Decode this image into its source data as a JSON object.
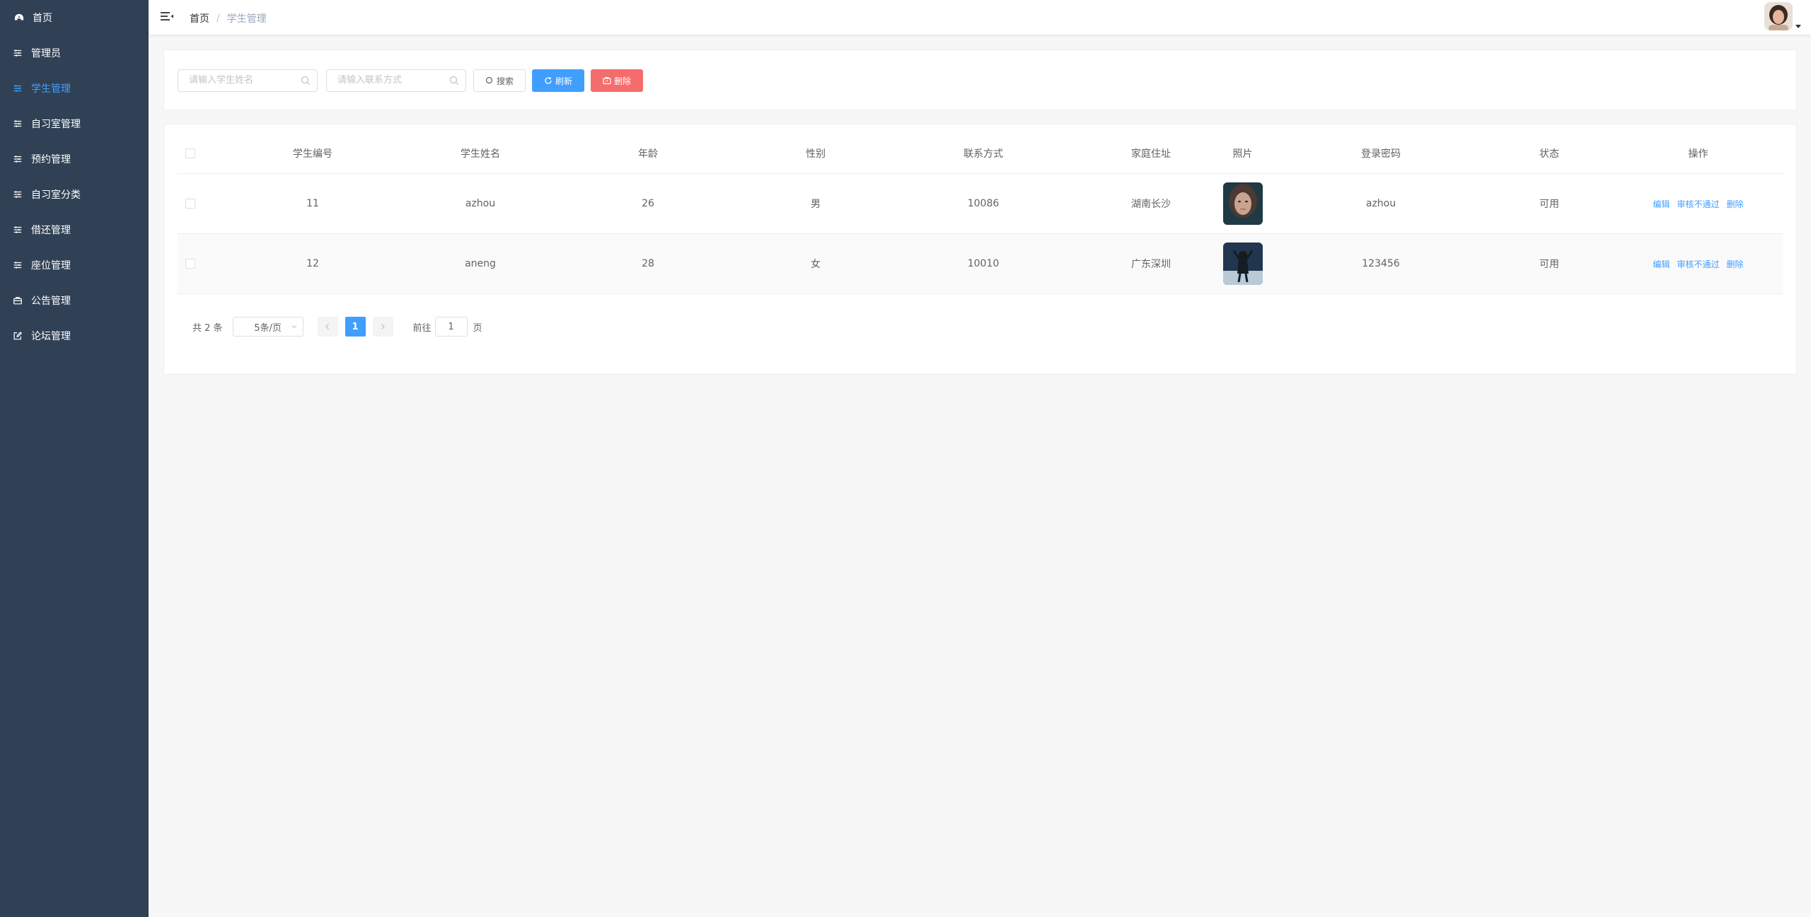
{
  "sidebar": {
    "items": [
      {
        "label": "首页",
        "icon": "dashboard-icon"
      },
      {
        "label": "管理员",
        "icon": "sliders-icon"
      },
      {
        "label": "学生管理",
        "icon": "sliders-icon",
        "active": true
      },
      {
        "label": "自习室管理",
        "icon": "sliders-icon"
      },
      {
        "label": "预约管理",
        "icon": "sliders-icon"
      },
      {
        "label": "自习室分类",
        "icon": "sliders-icon"
      },
      {
        "label": "借还管理",
        "icon": "sliders-icon"
      },
      {
        "label": "座位管理",
        "icon": "sliders-icon"
      },
      {
        "label": "公告管理",
        "icon": "briefcase-icon"
      },
      {
        "label": "论坛管理",
        "icon": "edit-icon"
      }
    ]
  },
  "header": {
    "breadcrumb_home": "首页",
    "breadcrumb_separator": "/",
    "breadcrumb_current": "学生管理"
  },
  "search": {
    "name_placeholder": "请输入学生姓名",
    "phone_placeholder": "请输入联系方式",
    "search_label": "搜索",
    "refresh_label": "刷新",
    "delete_label": "删除"
  },
  "table": {
    "headers": {
      "id": "学生编号",
      "name": "学生姓名",
      "age": "年龄",
      "sex": "性别",
      "phone": "联系方式",
      "address": "家庭住址",
      "photo": "照片",
      "password": "登录密码",
      "status": "状态",
      "ops": "操作"
    },
    "rows": [
      {
        "id": "11",
        "name": "azhou",
        "age": "26",
        "sex": "男",
        "phone": "10086",
        "address": "湖南长沙",
        "password": "azhou",
        "status": "可用"
      },
      {
        "id": "12",
        "name": "aneng",
        "age": "28",
        "sex": "女",
        "phone": "10010",
        "address": "广东深圳",
        "password": "123456",
        "status": "可用"
      }
    ],
    "op_edit": "编辑",
    "op_reject": "审核不通过",
    "op_delete": "删除"
  },
  "pagination": {
    "total": "共 2 条",
    "page_size": "5条/页",
    "current_page": "1",
    "goto_prefix": "前往",
    "goto_value": "1",
    "goto_suffix": "页"
  },
  "colors": {
    "sidebar_bg": "#304156",
    "accent": "#409eff",
    "danger": "#f56c6c"
  }
}
